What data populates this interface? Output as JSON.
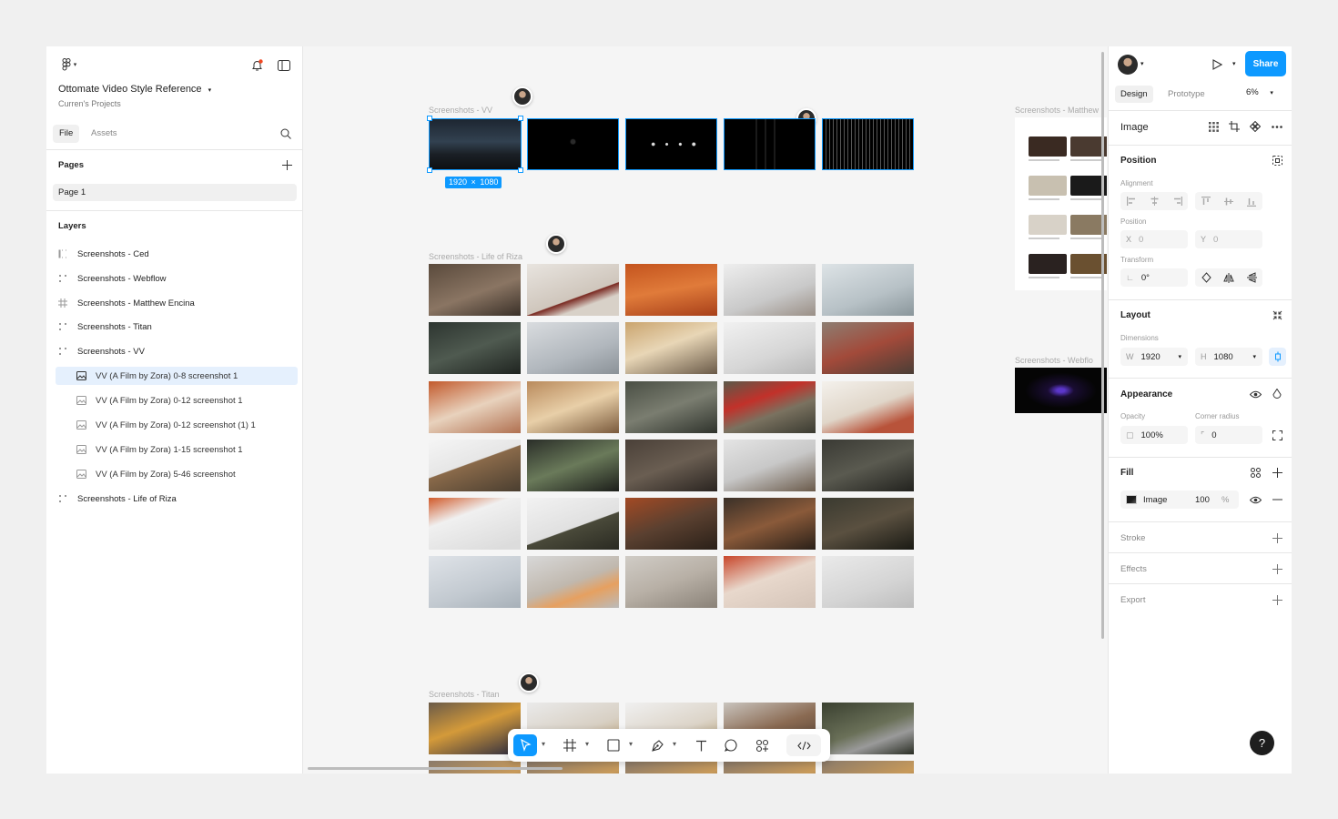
{
  "file": {
    "title": "Ottomate Video Style Reference",
    "project": "Curren's Projects"
  },
  "left_tabs": {
    "file": "File",
    "assets": "Assets"
  },
  "pages": {
    "heading": "Pages",
    "items": [
      "Page 1"
    ]
  },
  "layers": {
    "heading": "Layers",
    "items": [
      {
        "label": "Screenshots - Ced"
      },
      {
        "label": "Screenshots - Webflow"
      },
      {
        "label": "Screenshots - Matthew Encina"
      },
      {
        "label": "Screenshots - Titan"
      },
      {
        "label": "Screenshots - VV"
      },
      {
        "label": "VV (A Film by Zora) 0-8 screenshot 1"
      },
      {
        "label": "VV (A Film by Zora) 0-12 screenshot 1"
      },
      {
        "label": "VV (A Film by Zora) 0-12 screenshot (1) 1"
      },
      {
        "label": "VV (A Film by Zora) 1-15 screenshot 1"
      },
      {
        "label": "VV (A Film by Zora) 5-46 screenshot"
      },
      {
        "label": "Screenshots - Life of Riza"
      }
    ]
  },
  "canvas": {
    "frames": {
      "vv": "Screenshots - VV",
      "riza": "Screenshots - Life of Riza",
      "titan": "Screenshots - Titan",
      "matthew": "Screenshots - Matthew",
      "webflow": "Screenshots - Webflo"
    },
    "dimension_badge": {
      "w": "1920",
      "h": "1080"
    }
  },
  "right": {
    "share": "Share",
    "tabs": {
      "design": "Design",
      "prototype": "Prototype"
    },
    "zoom": "6%",
    "selection_type": "Image",
    "position": {
      "heading": "Position",
      "alignment_label": "Alignment",
      "position_label": "Position",
      "x_label": "X",
      "x_value": "0",
      "y_label": "Y",
      "y_value": "0",
      "transform_label": "Transform",
      "rotation": "0°"
    },
    "layout": {
      "heading": "Layout",
      "dimensions_label": "Dimensions",
      "w_label": "W",
      "w_value": "1920",
      "h_label": "H",
      "h_value": "1080"
    },
    "appearance": {
      "heading": "Appearance",
      "opacity_label": "Opacity",
      "opacity_value": "100%",
      "radius_label": "Corner radius",
      "radius_value": "0"
    },
    "fill": {
      "heading": "Fill",
      "type": "Image",
      "opacity": "100",
      "unit": "%"
    },
    "stroke": "Stroke",
    "effects": "Effects",
    "export": "Export",
    "help": "?"
  }
}
